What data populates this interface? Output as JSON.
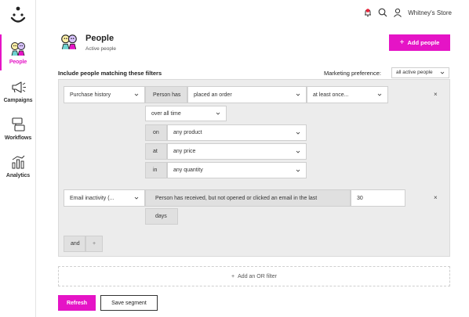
{
  "sidebar": {
    "items": [
      {
        "label": "People",
        "icon": "people-icon"
      },
      {
        "label": "Campaigns",
        "icon": "megaphone-icon"
      },
      {
        "label": "Workflows",
        "icon": "workflow-icon"
      },
      {
        "label": "Analytics",
        "icon": "chart-icon"
      }
    ]
  },
  "topbar": {
    "store_name": "Whitney's Store"
  },
  "header": {
    "title": "People",
    "subtitle": "Active people",
    "add_button": "Add people",
    "add_button_icon": "+"
  },
  "filters": {
    "heading": "Include people matching these filters",
    "marketing_label": "Marketing preference:",
    "marketing_value": "all active people",
    "group1": {
      "type": "Purchase history",
      "person_has": "Person has",
      "action": "placed an order",
      "frequency": "at least once...",
      "period": "over all time",
      "on_label": "on",
      "on_value": "any product",
      "at_label": "at",
      "at_value": "any price",
      "in_label": "in",
      "in_value": "any quantity"
    },
    "group2": {
      "type": "Email inactivity (...",
      "description": "Person has received, but not opened or clicked an email in the last",
      "value": "30",
      "unit": "days"
    },
    "and_label": "and",
    "plus_label": "+",
    "close_symbol": "×",
    "or_filter": "Add an OR filter",
    "or_plus": "+"
  },
  "actions": {
    "refresh": "Refresh",
    "save": "Save segment"
  },
  "colors": {
    "accent": "#e514c6",
    "notification": "#e8253b"
  }
}
